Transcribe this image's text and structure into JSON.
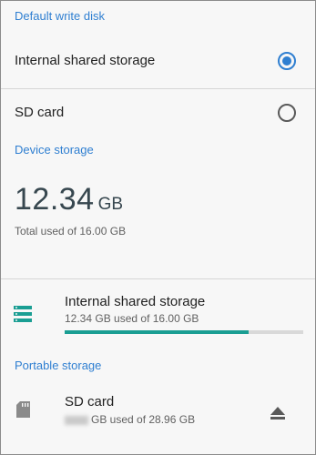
{
  "default_write_disk": {
    "header": "Default write disk",
    "options": [
      {
        "label": "Internal shared storage",
        "selected": true
      },
      {
        "label": "SD card",
        "selected": false
      }
    ]
  },
  "device_storage": {
    "header": "Device storage",
    "used_value": "12.34",
    "used_unit": "GB",
    "total_label": "Total used of 16.00 GB",
    "internal": {
      "icon": "storage-list-icon",
      "title": "Internal shared storage",
      "subtitle": "12.34 GB used of 16.00 GB",
      "progress_fraction": 0.771
    }
  },
  "portable_storage": {
    "header": "Portable storage",
    "sd": {
      "icon": "sd-card-icon",
      "title": "SD card",
      "subtitle_suffix": "GB used of 28.96 GB",
      "action_icon": "eject-icon"
    }
  },
  "colors": {
    "accent": "#2f7fd1",
    "progress": "#1a9e93",
    "storage_icon": "#1a9e93"
  }
}
